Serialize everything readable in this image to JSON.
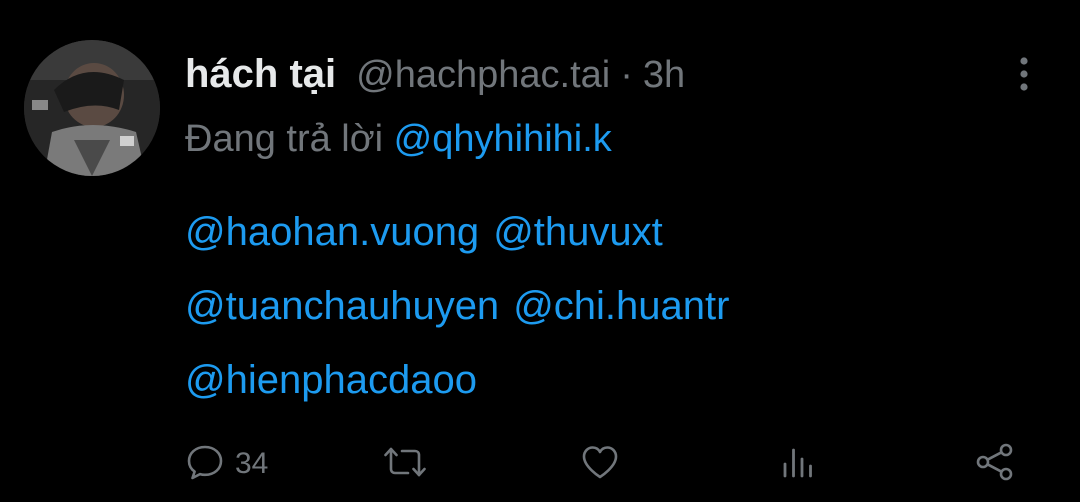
{
  "author": {
    "display_name": "hách tại",
    "handle": "@hachphac.tai",
    "separator": "·",
    "time": "3h"
  },
  "reply": {
    "prefix": "Đang trả lời",
    "to": "@qhyhihihi.k"
  },
  "mentions": {
    "line1": [
      "@haohan.vuong",
      "@thuvuxt"
    ],
    "line2": [
      "@tuanchauhuyen",
      "@chi.huantr"
    ],
    "line3": [
      "@hienphacdaoo"
    ]
  },
  "actions": {
    "reply_count": "34",
    "reply_icon": "speech-bubble-icon",
    "retweet_icon": "retweet-icon",
    "like_icon": "heart-icon",
    "views_icon": "bar-chart-icon",
    "share_icon": "share-icon",
    "more_icon": "more-vertical-icon"
  },
  "colors": {
    "background": "#000000",
    "primary_text": "#e7e9ea",
    "secondary_text": "#71767b",
    "link": "#1d9bf0"
  }
}
